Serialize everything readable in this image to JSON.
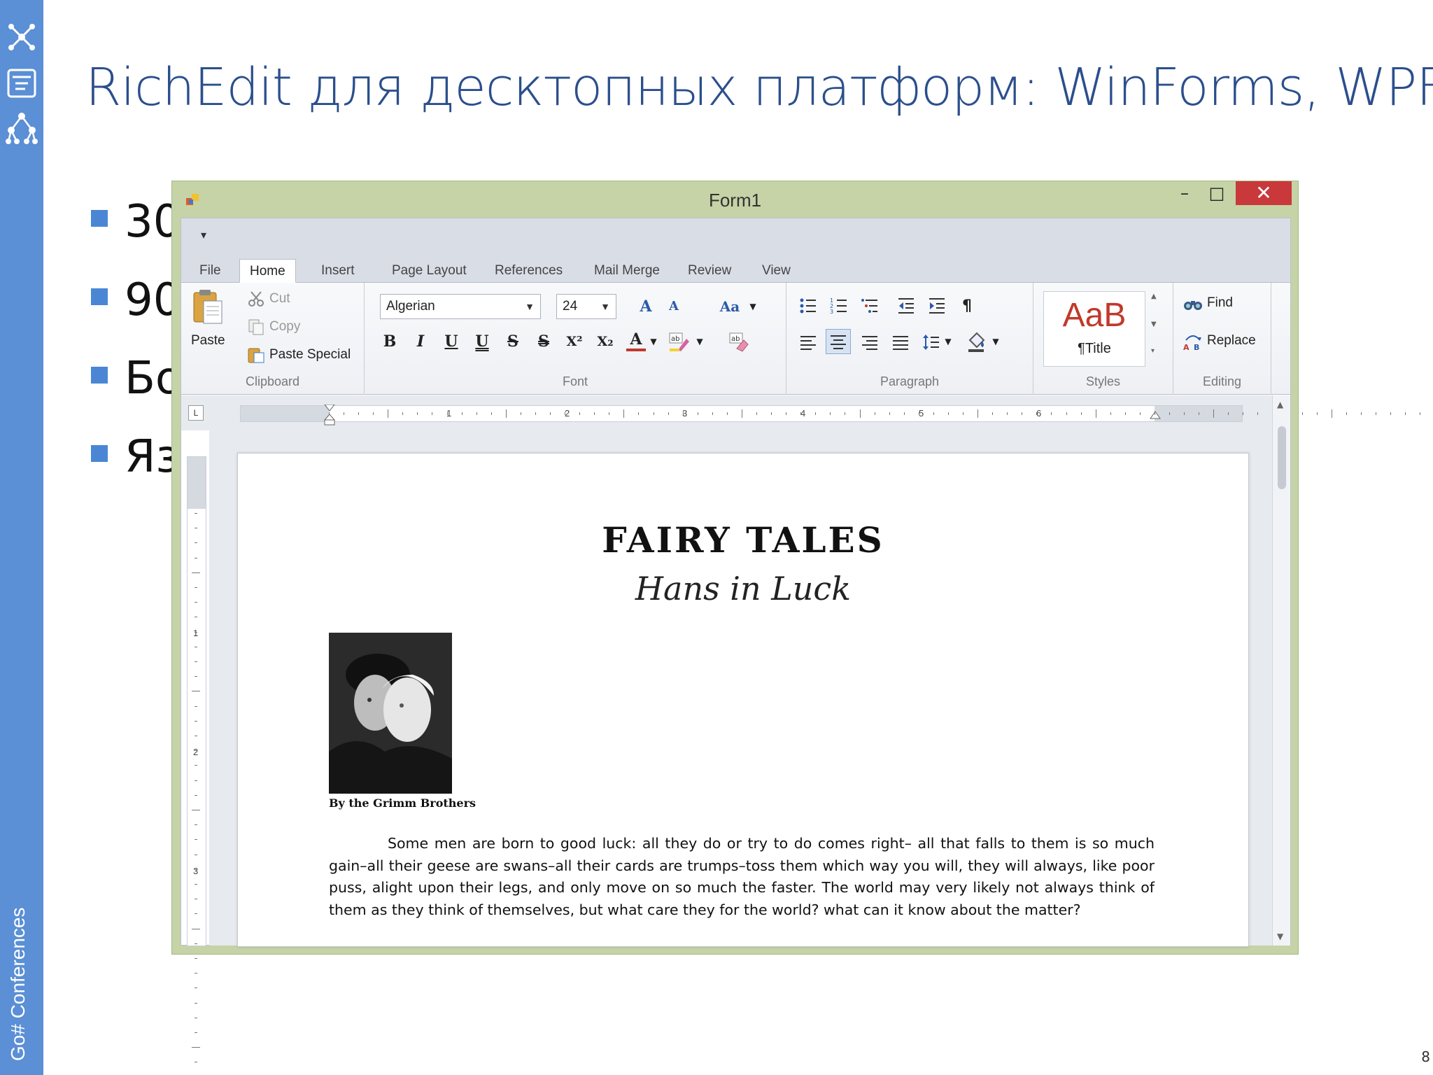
{
  "slide": {
    "title": "RichEdit для десктопных платформ: WinForms, WPF",
    "bullets": [
      "30",
      "90",
      "Бо",
      "Яз"
    ],
    "page_number": "8",
    "sidebar_brand": "Go# Conferences",
    "accent_color": "#5b8fd6"
  },
  "window": {
    "title": "Form1",
    "minimize": "–",
    "maximize": "□",
    "close": "✕",
    "tabs": [
      "File",
      "Home",
      "Insert",
      "Page Layout",
      "References",
      "Mail Merge",
      "Review",
      "View"
    ],
    "active_tab": "Home"
  },
  "ribbon": {
    "clipboard": {
      "label": "Clipboard",
      "paste": "Paste",
      "cut": "Cut",
      "copy": "Copy",
      "paste_special": "Paste Special"
    },
    "font": {
      "label": "Font",
      "font_name": "Algerian",
      "font_size": "24",
      "grow": "A",
      "shrink": "A",
      "change_case": "Aa",
      "bold": "B",
      "italic": "I",
      "underline": "U",
      "double_underline": "U",
      "strike": "S",
      "double_strike": "S",
      "superscript": "X²",
      "subscript": "X₂",
      "font_color": "A"
    },
    "paragraph": {
      "label": "Paragraph"
    },
    "styles": {
      "label": "Styles",
      "sample": "AaB",
      "name": "¶Title"
    },
    "editing": {
      "label": "Editing",
      "find": "Find",
      "replace": "Replace"
    }
  },
  "ruler": {
    "corner": "L",
    "h_numbers": [
      "1",
      "2",
      "3",
      "4",
      "5",
      "6"
    ],
    "v_numbers": [
      "1",
      "2",
      "3"
    ]
  },
  "document": {
    "title": "FAIRY TALES",
    "subtitle": "Hans in Luck",
    "caption": "By the Grimm Brothers",
    "body": "Some men are born to good luck: all they do or try to do comes right– all that falls to them is so much gain–all their geese are swans–all their cards are trumps–toss them which way you will, they will always, like poor puss, alight upon their legs, and only move on so much the faster. The world may very likely not always think of them as they think of themselves, but what care they for the world? what can it know about the matter?"
  }
}
